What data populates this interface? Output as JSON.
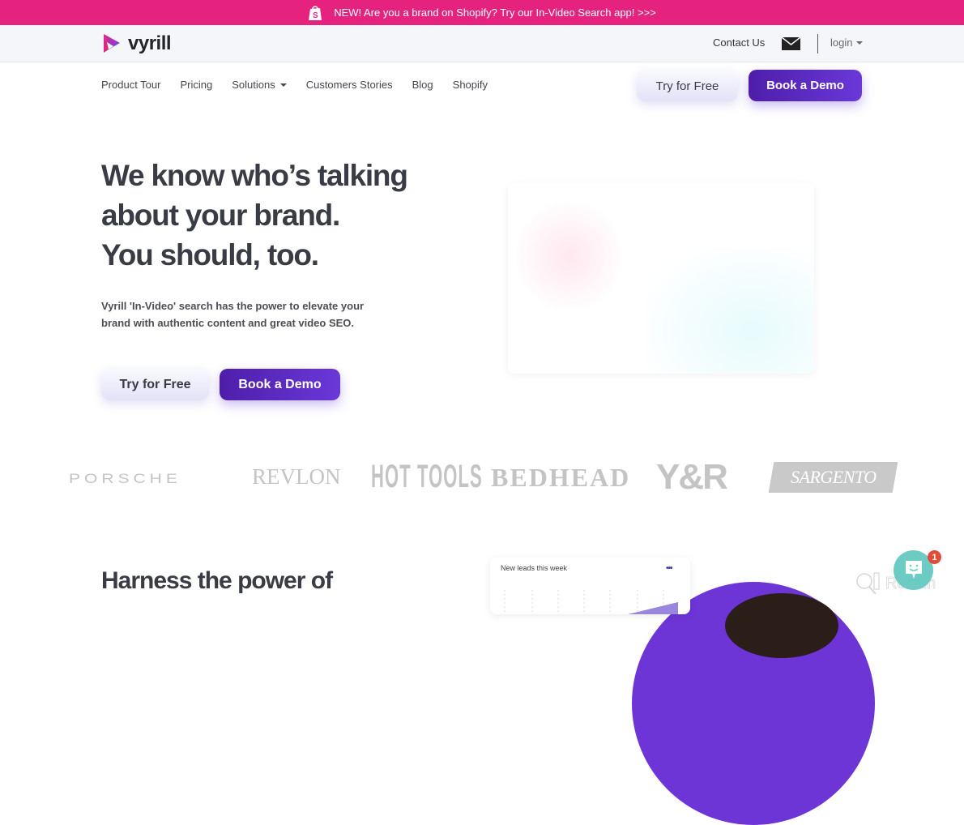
{
  "announcement": {
    "icon": "shopify-bag-icon",
    "text": "NEW! Are you a brand on Shopify? Try our In-Video Search app! >>>",
    "background": "#e5237f"
  },
  "topbar": {
    "logo_text": "vyrill",
    "contact_label": "Contact Us",
    "mail_icon": "envelope-icon",
    "login_label": "login"
  },
  "nav": {
    "items": [
      {
        "label": "Product Tour",
        "has_dropdown": false
      },
      {
        "label": "Pricing",
        "has_dropdown": false
      },
      {
        "label": "Solutions",
        "has_dropdown": true
      },
      {
        "label": "Customers Stories",
        "has_dropdown": false
      },
      {
        "label": "Blog",
        "has_dropdown": false
      },
      {
        "label": "Shopify",
        "has_dropdown": false
      }
    ],
    "try_free_label": "Try for Free",
    "book_demo_label": "Book a Demo"
  },
  "hero": {
    "title_line1": "We know who’s talking",
    "title_line2": "about your brand.",
    "title_line3": "You should, too.",
    "description": "Vyrill 'In-Video' search has the power to elevate your brand with authentic content and great video SEO.",
    "try_free_label": "Try for Free",
    "book_demo_label": "Book a Demo"
  },
  "brand_logos": [
    "PORSCHE",
    "REVLON",
    "HOT TOOLS",
    "BEDHEAD",
    "Y&R",
    "SARGENTO"
  ],
  "section2": {
    "title": "Harness the power of",
    "card_title": "New leads this week",
    "card_menu": "•••"
  },
  "chat_widget": {
    "badge_count": "1",
    "watermark": "Revain"
  },
  "colors": {
    "accent_purple": "#5a27c0",
    "announcement_pink": "#e5237f",
    "chat_teal": "#6cccc3"
  }
}
